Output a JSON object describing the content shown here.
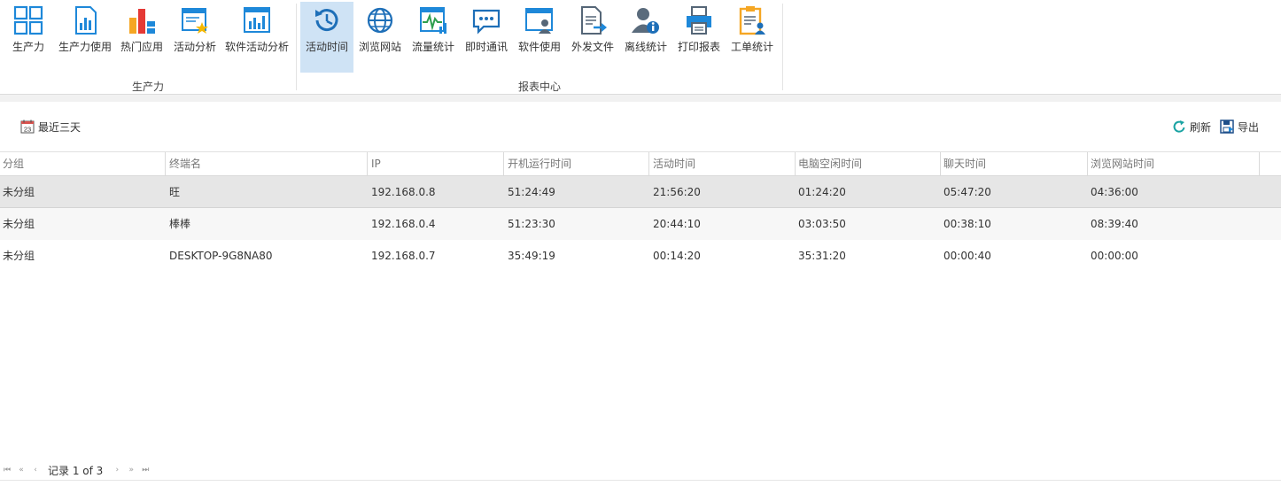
{
  "ribbon": {
    "groups": [
      {
        "label": "生产力"
      },
      {
        "label": "报表中心"
      }
    ],
    "productivity_buttons": [
      {
        "label": "生产力",
        "icon": "grid-icon"
      },
      {
        "label": "生产力使用",
        "icon": "bar-report-icon"
      },
      {
        "label": "热门应用",
        "icon": "app-blocks-icon"
      },
      {
        "label": "活动分析",
        "icon": "star-window-icon"
      },
      {
        "label": "软件活动分析",
        "icon": "window-chart-icon"
      }
    ],
    "report_buttons": [
      {
        "label": "活动时间",
        "icon": "clock-icon",
        "active": true
      },
      {
        "label": "浏览网站",
        "icon": "globe-icon"
      },
      {
        "label": "流量统计",
        "icon": "traffic-chart-icon"
      },
      {
        "label": "即时通讯",
        "icon": "chat-bubble-icon"
      },
      {
        "label": "软件使用",
        "icon": "window-user-icon"
      },
      {
        "label": "外发文件",
        "icon": "file-send-icon"
      },
      {
        "label": "离线统计",
        "icon": "user-info-icon"
      },
      {
        "label": "打印报表",
        "icon": "printer-icon"
      },
      {
        "label": "工单统计",
        "icon": "clipboard-user-icon"
      }
    ]
  },
  "toolbar": {
    "date_range_label": "最近三天",
    "calendar_day": "23",
    "refresh_label": "刷新",
    "export_label": "导出"
  },
  "table": {
    "columns": [
      "分组",
      "终端名",
      "IP",
      "开机运行时间",
      "活动时间",
      "电脑空闲时间",
      "聊天时间",
      "浏览网站时间"
    ],
    "rows": [
      [
        "未分组",
        "旺",
        "192.168.0.8",
        "51:24:49",
        "21:56:20",
        "01:24:20",
        "05:47:20",
        "04:36:00"
      ],
      [
        "未分组",
        "棒棒",
        "192.168.0.4",
        "51:23:30",
        "20:44:10",
        "03:03:50",
        "00:38:10",
        "08:39:40"
      ],
      [
        "未分组",
        "DESKTOP-9G8NA80",
        "192.168.0.7",
        "35:49:19",
        "00:14:20",
        "35:31:20",
        "00:00:40",
        "00:00:00"
      ]
    ]
  },
  "pager": {
    "text": "记录 1 of 3",
    "first": "⏮",
    "prev_page": "«",
    "prev": "‹",
    "next": "›",
    "next_page": "»",
    "last": "⏭"
  },
  "colors": {
    "accent": "#1e88d9",
    "active_bg": "#cfe3f5",
    "selected_row": "#e6e6e6"
  }
}
